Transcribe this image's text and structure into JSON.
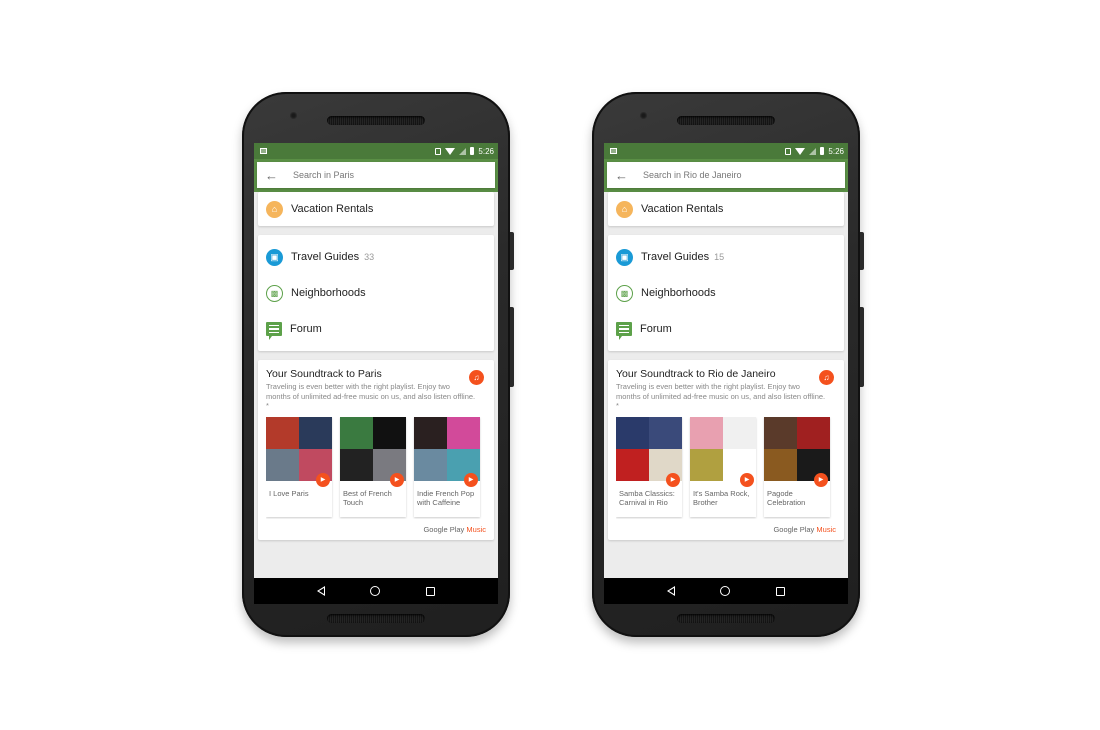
{
  "phones": [
    {
      "status": {
        "time": "5:26"
      },
      "search": {
        "placeholder": "Search in Paris"
      },
      "vacation": {
        "label": "Vacation Rentals"
      },
      "nav": [
        {
          "label": "Travel Guides",
          "count": "33",
          "icon": "book-icon"
        },
        {
          "label": "Neighborhoods",
          "count": "",
          "icon": "buildings-icon"
        },
        {
          "label": "Forum",
          "count": "",
          "icon": "chat-icon"
        }
      ],
      "music": {
        "title": "Your Soundtrack to Paris",
        "desc": "Traveling is even better with the right playlist. Enjoy two months of unlimited ad-free music on us, and also listen offline. *",
        "playlists": [
          {
            "name": "I Love Paris",
            "colors": [
              "#b33a2a",
              "#2a3a5a",
              "#6a7a8a",
              "#c04a60"
            ]
          },
          {
            "name": "Best of French Touch",
            "colors": [
              "#3a7a40",
              "#111111",
              "#222222",
              "#7a7a80"
            ]
          },
          {
            "name": "Indie French Pop with Caffeine",
            "colors": [
              "#2a2020",
              "#d24a9a",
              "#6a8aa0",
              "#4aa0b0"
            ]
          }
        ],
        "brand": "Google Play",
        "brand_accent": "Music"
      }
    },
    {
      "status": {
        "time": "5:26"
      },
      "search": {
        "placeholder": "Search in Rio de Janeiro"
      },
      "vacation": {
        "label": "Vacation Rentals"
      },
      "nav": [
        {
          "label": "Travel Guides",
          "count": "15",
          "icon": "book-icon"
        },
        {
          "label": "Neighborhoods",
          "count": "",
          "icon": "buildings-icon"
        },
        {
          "label": "Forum",
          "count": "",
          "icon": "chat-icon"
        }
      ],
      "music": {
        "title": "Your Soundtrack to Rio de Janeiro",
        "desc": "Traveling is even better with the right playlist. Enjoy two months of unlimited ad-free music on us, and also listen offline. *",
        "playlists": [
          {
            "name": "Samba Classics: Carnival in Rio",
            "colors": [
              "#2a3a6a",
              "#3a4a7a",
              "#c02020",
              "#e0d8c8"
            ]
          },
          {
            "name": "It's Samba Rock, Brother",
            "colors": [
              "#e8a0b0",
              "#f0f0f0",
              "#b0a040",
              "#ffffff"
            ]
          },
          {
            "name": "Pagode Celebration",
            "colors": [
              "#5a3a2a",
              "#a02020",
              "#8a5a20",
              "#1a1a1a"
            ]
          }
        ],
        "brand": "Google Play",
        "brand_accent": "Music"
      }
    }
  ],
  "colors": {
    "statusbar": "#4a7a3a",
    "searchbar": "#5a8f45",
    "accent": "#f4511e"
  }
}
